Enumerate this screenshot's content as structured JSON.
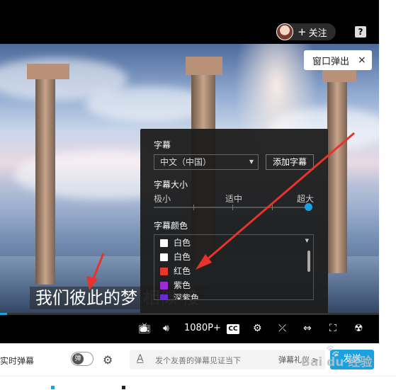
{
  "header": {
    "follow_label": "关注",
    "plus": "+",
    "help": "?"
  },
  "popout": {
    "label": "窗口弹出",
    "close": "×"
  },
  "subtitle": {
    "text": "我们彼此的梦  相似 接"
  },
  "panel": {
    "subtitle_heading": "字幕",
    "language_value": "中文（中国）",
    "add_button": "添加字幕",
    "size_heading": "字幕大小",
    "size_options": [
      "极小",
      "适中",
      "超大"
    ],
    "size_level_percent": 100,
    "color_heading": "字幕颜色",
    "colors": [
      {
        "label": "白色",
        "color": "#ffffff"
      },
      {
        "label": "白色",
        "color": "#ffffff"
      },
      {
        "label": "红色",
        "color": "#e5372d"
      },
      {
        "label": "紫色",
        "color": "#9b2bd6"
      },
      {
        "label": "深紫色",
        "color": "#6a2bd6"
      }
    ]
  },
  "controls": {
    "quality": "1080P+",
    "cc": "CC"
  },
  "bottom": {
    "realtime_label": "实时弹幕",
    "toggle_label": "弹",
    "input_placeholder": "发个友善的弹幕见证当下",
    "etiquette": "弹幕礼仪 >",
    "send": "发送"
  },
  "watermark": "Bai du 经验",
  "colors": {
    "accent": "#1aa1e0",
    "arrow": "#e8332c"
  }
}
